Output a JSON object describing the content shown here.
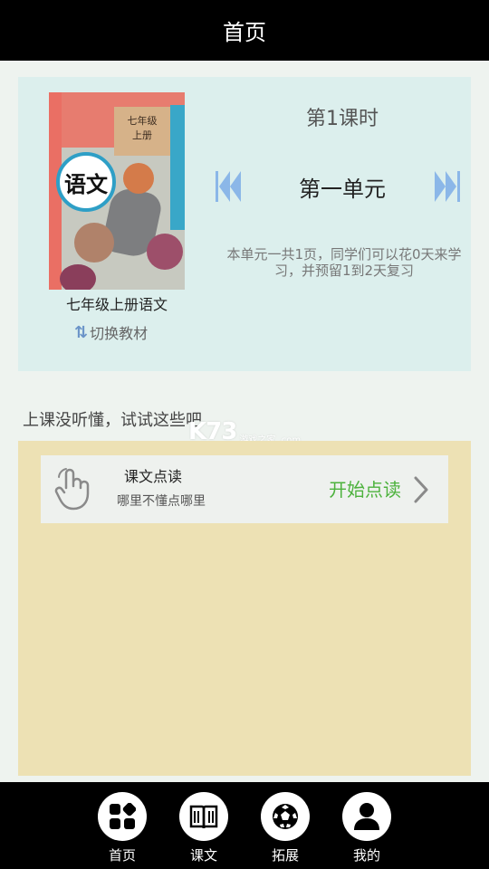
{
  "header": {
    "title": "首页"
  },
  "book": {
    "cover_subject": "语文",
    "cover_grade": "七年级",
    "cover_term": "上册",
    "title": "七年级上册语文",
    "switch_label": "切换教材"
  },
  "lesson": {
    "period": "第1课时",
    "unit": "第一单元",
    "description": "本单元一共1页，同学们可以花0天来学习，并预留1到2天复习"
  },
  "section": {
    "label": "上课没听懂，试试这些吧"
  },
  "watermark": {
    "logo": "K73",
    "text": "游戏之家 .com"
  },
  "read_card": {
    "title": "课文点读",
    "subtitle": "哪里不懂点哪里",
    "action": "开始点读"
  },
  "bottom_nav": {
    "items": [
      {
        "label": "首页",
        "icon": "home-grid-icon"
      },
      {
        "label": "课文",
        "icon": "book-icon"
      },
      {
        "label": "拓展",
        "icon": "ball-icon"
      },
      {
        "label": "我的",
        "icon": "user-icon"
      }
    ]
  },
  "colors": {
    "header_bg": "#000000",
    "card_bg": "#dcefed",
    "panel_bg": "#ede1b4",
    "accent_green": "#4db23d",
    "arrow_blue": "#8bb7e8"
  }
}
